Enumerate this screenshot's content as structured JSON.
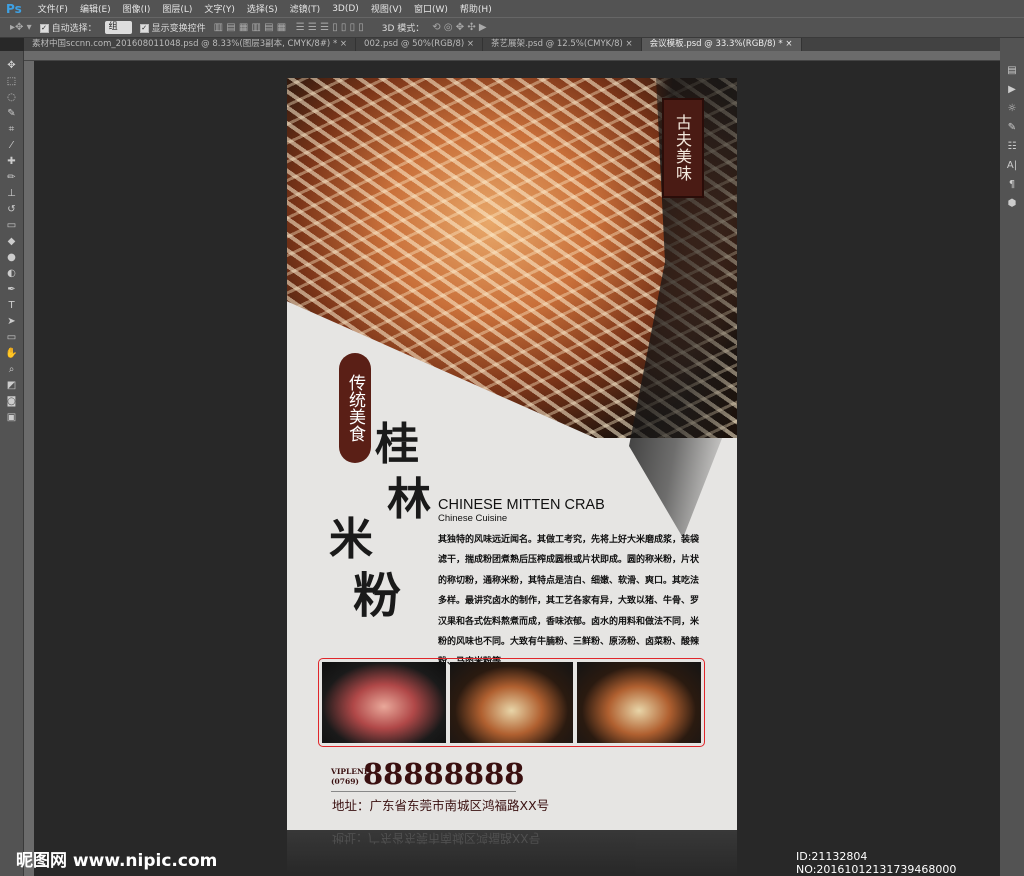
{
  "app": {
    "logo": "Ps"
  },
  "menu": [
    "文件(F)",
    "编辑(E)",
    "图像(I)",
    "图层(L)",
    "文字(Y)",
    "选择(S)",
    "滤镜(T)",
    "3D(D)",
    "视图(V)",
    "窗口(W)",
    "帮助(H)"
  ],
  "options": {
    "auto_select_label": "自动选择：",
    "auto_select_value": "组",
    "show_transform_label": "显示变换控件",
    "mode_3d_label": "3D 模式："
  },
  "tabs": [
    {
      "label": "素材中国sccnn.com_201608011048.psd @ 8.33%(图层3副本, CMYK/8#) *",
      "active": false
    },
    {
      "label": "002.psd @ 50%(RGB/8)",
      "active": false
    },
    {
      "label": "茶艺展架.psd @ 12.5%(CMYK/8)",
      "active": false
    },
    {
      "label": "会议模板.psd @ 33.3%(RGB/8) *",
      "active": true
    }
  ],
  "poster": {
    "seal": "古夫美味",
    "tag": "传统美食",
    "title_chars": [
      "桂",
      "林",
      "米",
      "粉"
    ],
    "en_title": "CHINESE MITTEN CRAB",
    "en_subtitle": "Chinese  Cuisine",
    "body": "其独特的风味远近闻名。其做工考究，先将上好大米磨成浆，装袋滤干，揣成粉团煮熟后压榨成圆根或片状即成。圆的称米粉，片状的称切粉，通称米粉，其特点是洁白、细嫩、软滑、爽口。其吃法多样。最讲究卤水的制作，其工艺各家有异，大致以猪、牛骨、罗汉果和各式佐料熬煮而成，香味浓郁。卤水的用料和做法不同，米粉的风味也不同。大致有牛腩粉、三鲜粉、原汤粉、卤菜粉、酸辣粉、马肉米粉等",
    "vip_label": "VIPLENE",
    "area_code": "(0769)",
    "phone": "88888888",
    "address": "地址：广东省东莞市南城区鸿福路XX号"
  },
  "watermark": "昵图网 www.nipic.com",
  "image_id": "ID:21132804 NO:20161012131739468000",
  "colors": {
    "accent_red": "#e0262a",
    "brand_brown": "#5a1f16"
  }
}
